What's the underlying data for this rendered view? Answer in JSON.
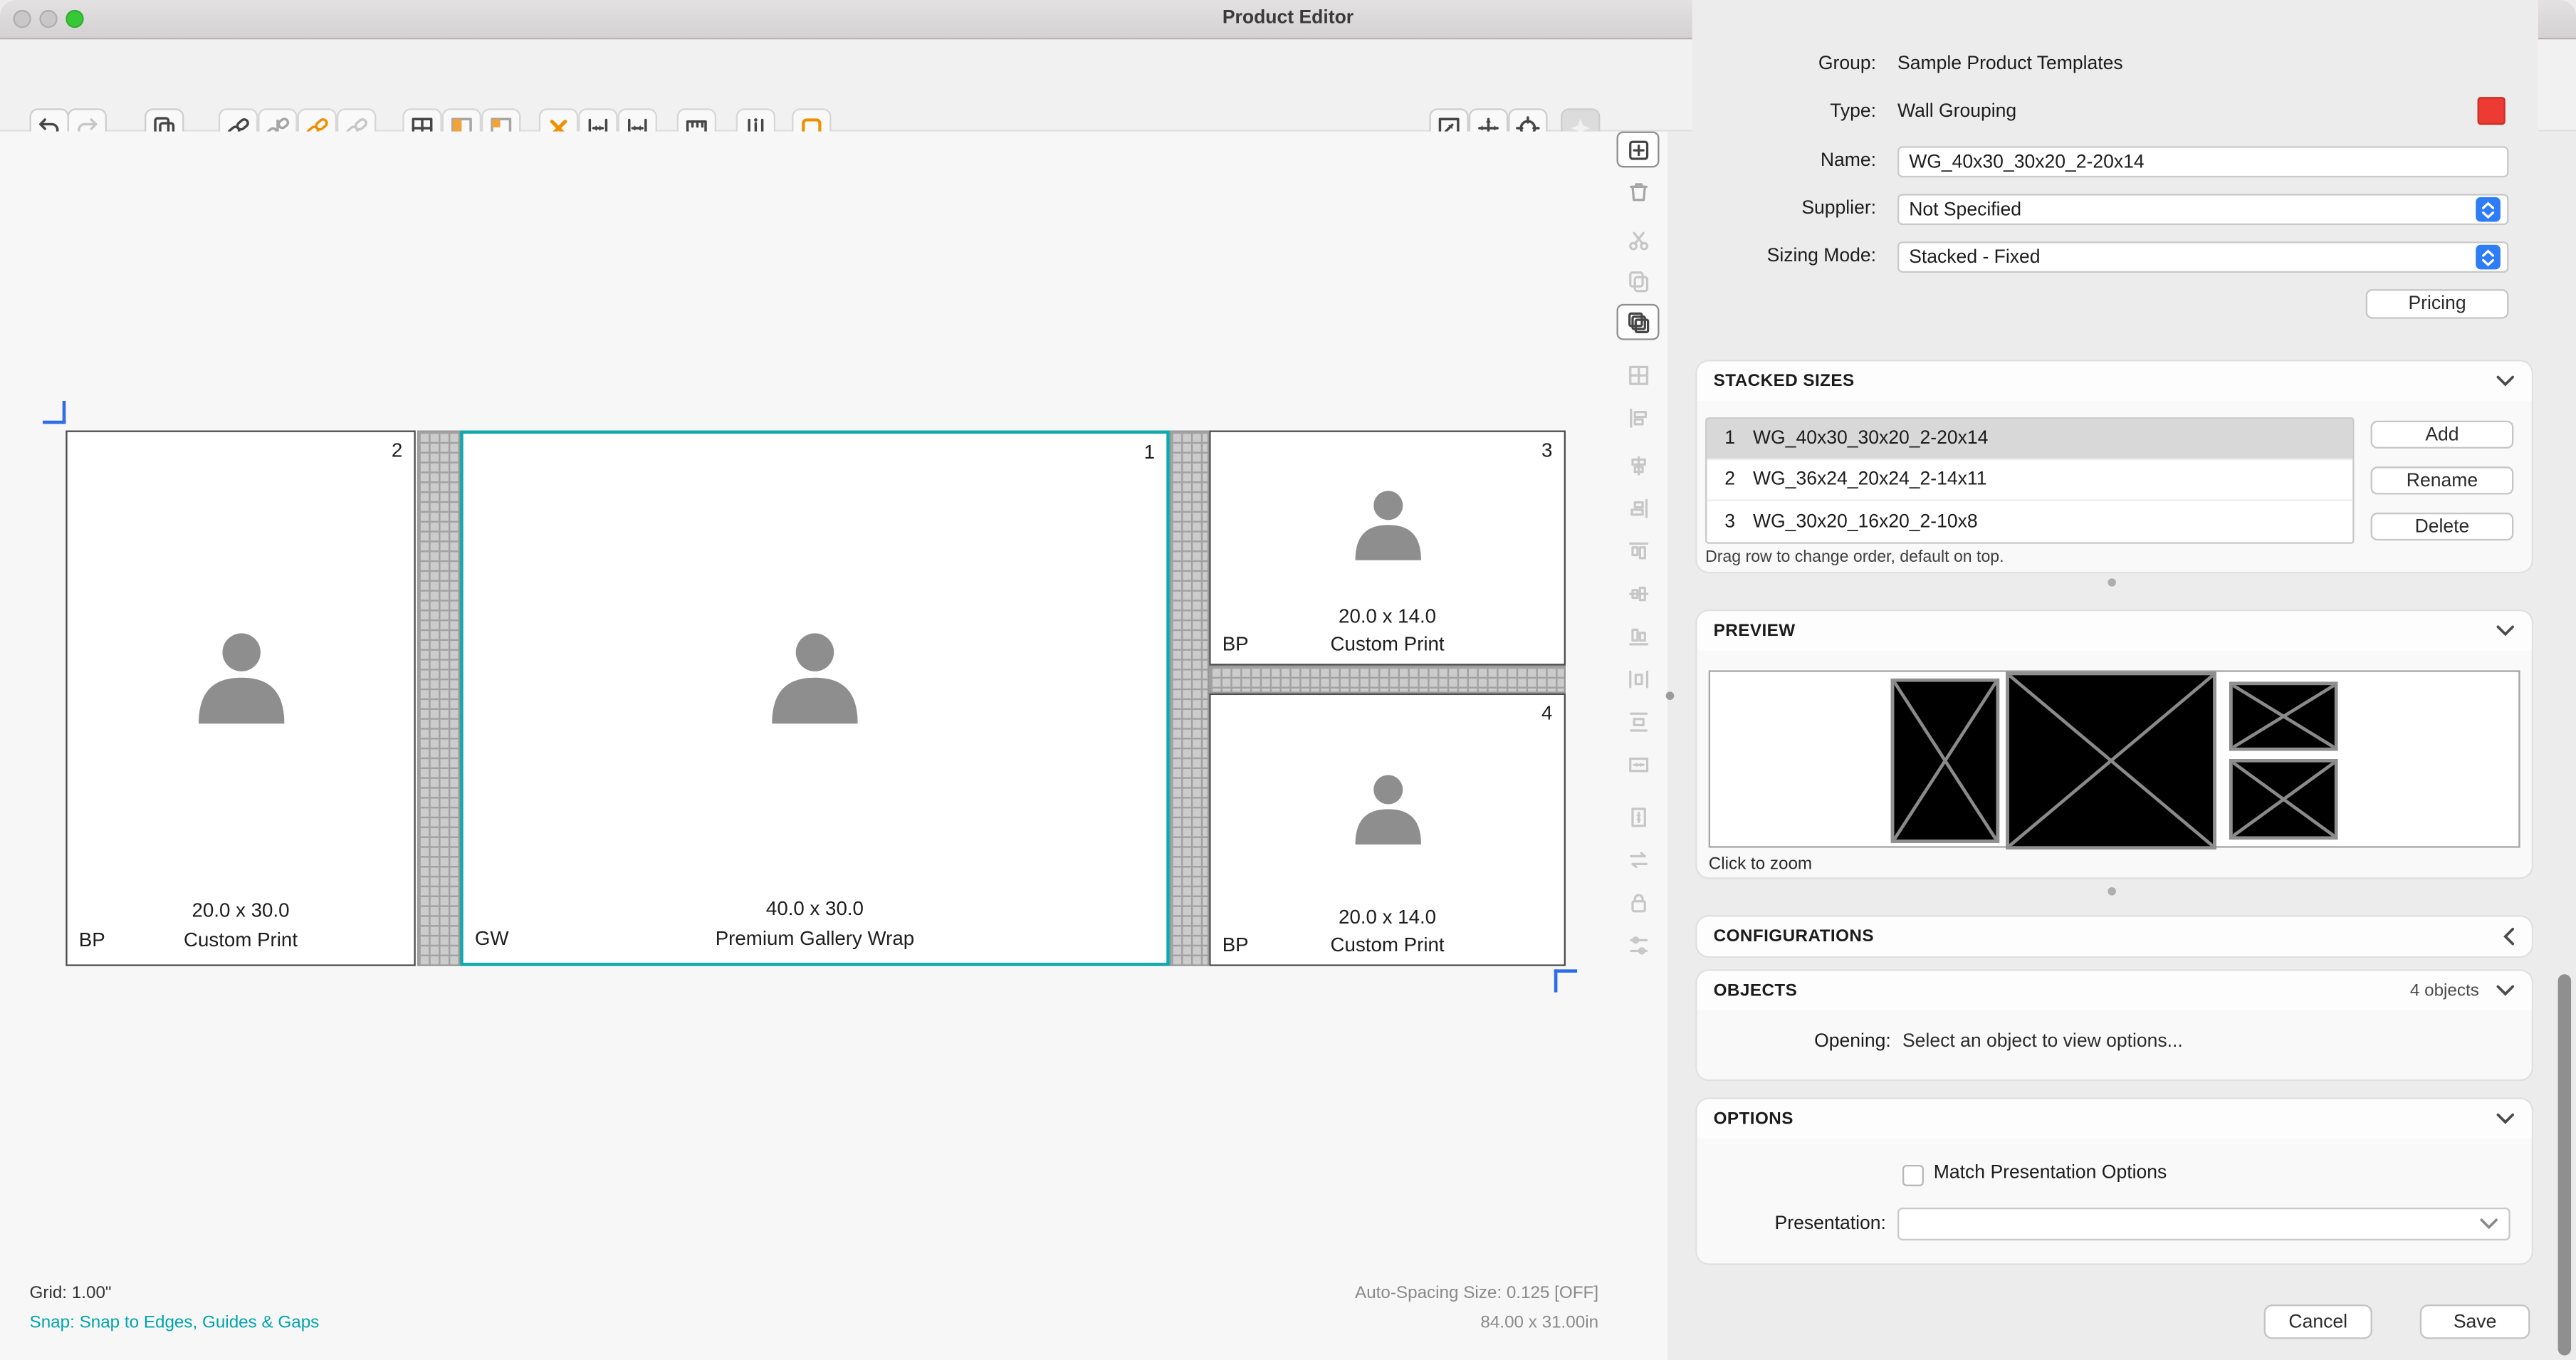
{
  "window": {
    "title": "Product Editor"
  },
  "canvas": {
    "frames": [
      {
        "number": "2",
        "size": "20.0 x 30.0",
        "product": "Custom Print",
        "code": "BP"
      },
      {
        "number": "1",
        "size": "40.0 x 30.0",
        "product": "Premium Gallery Wrap",
        "code": "GW"
      },
      {
        "number": "3",
        "size": "20.0 x 14.0",
        "product": "Custom Print",
        "code": "BP"
      },
      {
        "number": "4",
        "size": "20.0 x 14.0",
        "product": "Custom Print",
        "code": "BP"
      }
    ],
    "status_grid": "Grid: 1.00\"",
    "status_snap": "Snap: Snap to Edges, Guides & Gaps",
    "status_autospacing": "Auto-Spacing Size: 0.125 [OFF]",
    "status_dimensions": "84.00 x 31.00in"
  },
  "panel": {
    "group_label": "Group:",
    "group_value": "Sample Product Templates",
    "type_label": "Type:",
    "type_value": "Wall Grouping",
    "name_label": "Name:",
    "name_value": "WG_40x30_30x20_2-20x14",
    "supplier_label": "Supplier:",
    "supplier_value": "Not Specified",
    "sizing_label": "Sizing Mode:",
    "sizing_value": "Stacked - Fixed",
    "pricing_button": "Pricing",
    "stacked": {
      "title": "STACKED SIZES",
      "rows": [
        {
          "n": "1",
          "name": "WG_40x30_30x20_2-20x14"
        },
        {
          "n": "2",
          "name": "WG_36x24_20x24_2-14x11"
        },
        {
          "n": "3",
          "name": "WG_30x20_16x20_2-10x8"
        }
      ],
      "add": "Add",
      "rename": "Rename",
      "delete": "Delete",
      "hint": "Drag row to change order, default on top."
    },
    "preview": {
      "title": "PREVIEW",
      "caption": "Click to zoom"
    },
    "configurations": {
      "title": "CONFIGURATIONS"
    },
    "objects": {
      "title": "OBJECTS",
      "count": "4 objects",
      "opening_label": "Opening:",
      "opening_value": "Select an object to view options..."
    },
    "options": {
      "title": "OPTIONS",
      "match_label": "Match Presentation Options",
      "presentation_label": "Presentation:"
    }
  },
  "footer": {
    "cancel": "Cancel",
    "save": "Save"
  },
  "colors": {
    "accent_red": "#ed3b33",
    "selection_teal": "#13a7ab",
    "snap_teal": "#00a4ad",
    "stepper_blue": "#2e7cf6"
  }
}
